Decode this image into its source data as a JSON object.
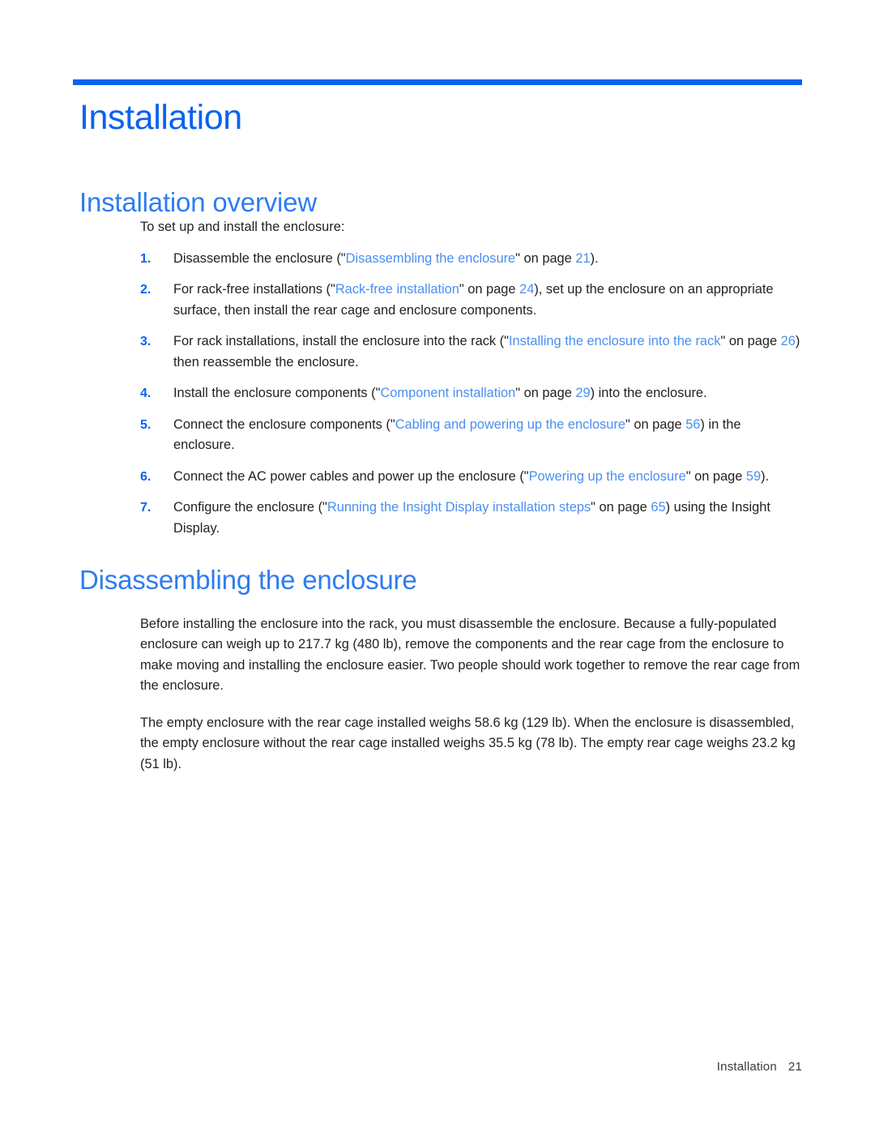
{
  "chapter": {
    "title": "Installation"
  },
  "sections": [
    {
      "heading": "Installation overview",
      "intro": "To set up and install the enclosure:",
      "steps": [
        {
          "num": "1.",
          "pre": "Disassemble the enclosure (\"",
          "xref": "Disassembling the enclosure",
          "mid": "\" on page ",
          "page": "21",
          "post": ")."
        },
        {
          "num": "2.",
          "pre": "For rack-free installations (\"",
          "xref": "Rack-free installation",
          "mid": "\" on page ",
          "page": "24",
          "post": "), set up the enclosure on an appropriate surface, then install the rear cage and enclosure components."
        },
        {
          "num": "3.",
          "pre": "For rack installations, install the enclosure into the rack (\"",
          "xref": "Installing the enclosure into the rack",
          "mid": "\" on page ",
          "page": "26",
          "post": ") then reassemble the enclosure."
        },
        {
          "num": "4.",
          "pre": "Install the enclosure components (\"",
          "xref": "Component installation",
          "mid": "\" on page ",
          "page": "29",
          "post": ") into the enclosure."
        },
        {
          "num": "5.",
          "pre": "Connect the enclosure components (\"",
          "xref": "Cabling and powering up the enclosure",
          "mid": "\" on page ",
          "page": "56",
          "post": ") in the enclosure."
        },
        {
          "num": "6.",
          "pre": "Connect the AC power cables and power up the enclosure (\"",
          "xref": "Powering up the enclosure",
          "mid": "\" on page ",
          "page": "59",
          "post": ")."
        },
        {
          "num": "7.",
          "pre": "Configure the enclosure (\"",
          "xref": "Running the Insight Display installation steps",
          "mid": "\" on page ",
          "page": "65",
          "post": ") using the Insight Display."
        }
      ]
    },
    {
      "heading": "Disassembling the enclosure",
      "paragraphs": [
        "Before installing the enclosure into the rack, you must disassemble the enclosure. Because a fully-populated enclosure can weigh up to 217.7 kg (480 lb), remove the components and the rear cage from the enclosure to make moving and installing the enclosure easier. Two people should work together to remove the rear cage from the enclosure.",
        "The empty enclosure with the rear cage installed weighs 58.6 kg (129 lb). When the enclosure is disassembled, the empty enclosure without the rear cage installed weighs 35.5 kg (78 lb). The empty rear cage weighs 23.2 kg (51 lb)."
      ]
    }
  ],
  "footer": {
    "label": "Installation",
    "page_number": "21"
  },
  "colors": {
    "chapter_rule": "#0a62f0",
    "chapter_title": "#0a62f0",
    "heading": "#2e7cf0",
    "xref_link": "#4a8ff0",
    "step_number": "#0a62f0",
    "body_text": "#231f20"
  }
}
